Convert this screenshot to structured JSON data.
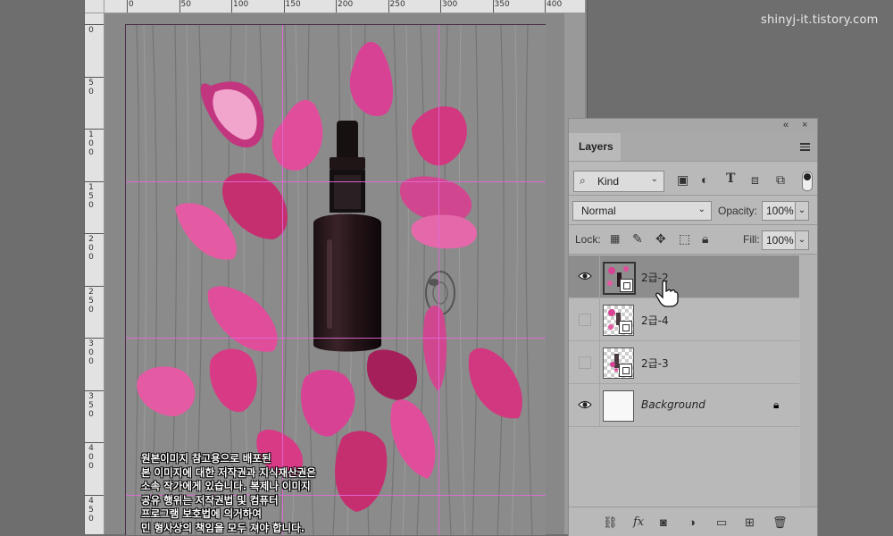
{
  "watermark": "shinyj-it.tistory.com",
  "document": {
    "ruler_top": [
      "0",
      "50",
      "100",
      "150",
      "200",
      "250",
      "300",
      "350",
      "400"
    ],
    "ruler_left": [
      [
        "0"
      ],
      [
        "5",
        "0"
      ],
      [
        "1",
        "0",
        "0"
      ],
      [
        "1",
        "5",
        "0"
      ],
      [
        "2",
        "0",
        "0"
      ],
      [
        "2",
        "5",
        "0"
      ],
      [
        "3",
        "0",
        "0"
      ],
      [
        "3",
        "5",
        "0"
      ],
      [
        "4",
        "0",
        "0"
      ],
      [
        "4",
        "5",
        "0"
      ]
    ],
    "overlay_lines": [
      "원본이미지 참고용으로 배포된",
      "본 이미지에 대한 저작권과 지식재산권은",
      "소속 작가에게 있습니다. 복제나 이미지",
      "공유 행위는 저작권법 및 컴퓨터",
      "프로그램 보호법에 의거하여",
      "민 형사상의 책임을 모두 져야 합니다."
    ],
    "colors": {
      "guide": "#e268d8",
      "petal": "#d63a8e",
      "wood": "#8a8a8a"
    }
  },
  "layers_panel": {
    "collapse_icon": "«",
    "close_icon": "×",
    "tab": "Layers",
    "kind_label": "Kind",
    "blend_mode": "Normal",
    "opacity_label": "Opacity:",
    "opacity_value": "100%",
    "lock_label": "Lock:",
    "fill_label": "Fill:",
    "fill_value": "100%",
    "layers": [
      {
        "name": "2급-2",
        "visible": true,
        "selected": true
      },
      {
        "name": "2급-4",
        "visible": false,
        "selected": false
      },
      {
        "name": "2급-3",
        "visible": false,
        "selected": false
      },
      {
        "name": "Background",
        "visible": true,
        "selected": false,
        "locked": true
      }
    ],
    "footer_icons": [
      "link-icon",
      "fx-icon",
      "mask-icon",
      "adjustment-icon",
      "folder-icon",
      "new-layer-icon",
      "trash-icon"
    ],
    "fx_label": "fx"
  }
}
